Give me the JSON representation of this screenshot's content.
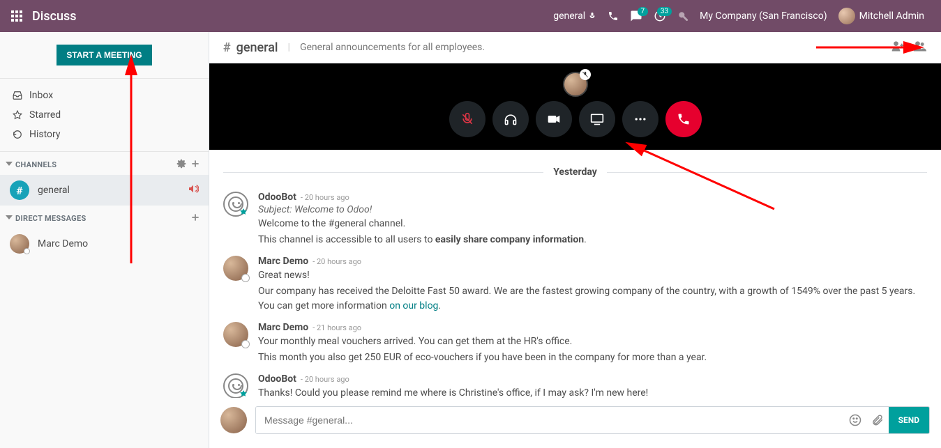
{
  "topbar": {
    "app_title": "Discuss",
    "channel_quick": "general",
    "msg_badge": "7",
    "activity_badge": "33",
    "company": "My Company (San Francisco)",
    "user": "Mitchell Admin"
  },
  "sidebar": {
    "start_meeting": "START A MEETING",
    "nav": {
      "inbox": "Inbox",
      "starred": "Starred",
      "history": "History"
    },
    "channels_header": "CHANNELS",
    "channels": [
      {
        "name": "general",
        "active": true,
        "audio": true
      }
    ],
    "dm_header": "DIRECT MESSAGES",
    "dms": [
      {
        "name": "Marc Demo"
      }
    ]
  },
  "channel": {
    "name": "general",
    "description": "General announcements for all employees."
  },
  "date_separator": "Yesterday",
  "messages": [
    {
      "author": "OdooBot",
      "time": "- 20 hours ago",
      "avatar": "bot",
      "subject": "Subject: Welcome to Odoo!",
      "lines": [
        "Welcome to the #general channel.",
        "This channel is accessible to all users to <strong>easily share company information</strong>."
      ]
    },
    {
      "author": "Marc Demo",
      "time": "- 20 hours ago",
      "avatar": "user",
      "lines": [
        "Great news!",
        "Our company has received the Deloitte Fast 50 award. We are the fastest growing company of the country, with a growth of 1549% over the past 5 years. You can get more information <a href='#'>on our blog</a>."
      ]
    },
    {
      "author": "Marc Demo",
      "time": "- 21 hours ago",
      "avatar": "user",
      "lines": [
        "Your monthly meal vouchers arrived. You can get them at the HR's office.",
        "This month you also get 250 EUR of eco-vouchers if you have been in the company for more than a year."
      ]
    },
    {
      "author": "OdooBot",
      "time": "- 20 hours ago",
      "avatar": "bot",
      "lines": [
        "Thanks! Could you please remind me where is Christine's office, if I may ask? I'm new here!"
      ]
    }
  ],
  "composer": {
    "placeholder": "Message #general...",
    "send": "SEND"
  }
}
